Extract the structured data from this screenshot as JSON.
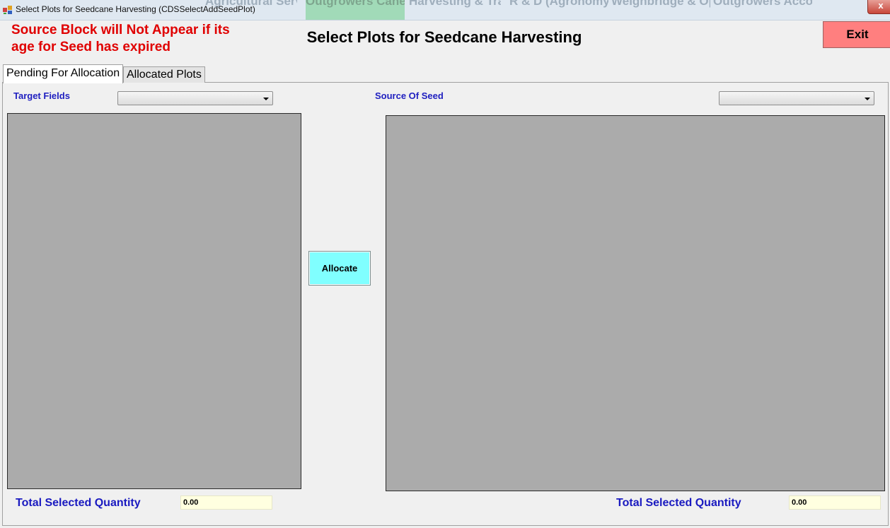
{
  "window": {
    "title": "Select Plots for Seedcane Harvesting (CDSSelectAddSeedPlot)",
    "close_label": "x",
    "background_tiles": [
      {
        "text": "Agricultural Servicing"
      },
      {
        "text": "Outgrowers Cane Dev"
      },
      {
        "text": "Harvesting & Transport"
      },
      {
        "text": "R & D (Agronomy)"
      },
      {
        "text": "Weighbridge & Operations"
      },
      {
        "text": "Outgrowers Accounts"
      }
    ]
  },
  "header": {
    "warning": "Source Block will Not Appear if its age for Seed has expired",
    "title": "Select Plots for Seedcane Harvesting",
    "exit_label": "Exit"
  },
  "tabs": [
    {
      "label": "Pending For Allocation",
      "active": true
    },
    {
      "label": "Allocated Plots",
      "active": false
    }
  ],
  "left": {
    "label": "Target Fields",
    "selected": "",
    "total_label": "Total Selected Quantity",
    "total_value": "0.00"
  },
  "right": {
    "label": "Source Of Seed",
    "selected": "",
    "total_label": "Total Selected Quantity",
    "total_value": "0.00"
  },
  "actions": {
    "allocate_label": "Allocate"
  },
  "colors": {
    "warning": "#e00000",
    "exit_button": "#ff7f7f",
    "allocate_button": "#80ffff",
    "grid": "#ababab",
    "label_blue": "#2020c0",
    "total_box": "#ffffe0"
  }
}
